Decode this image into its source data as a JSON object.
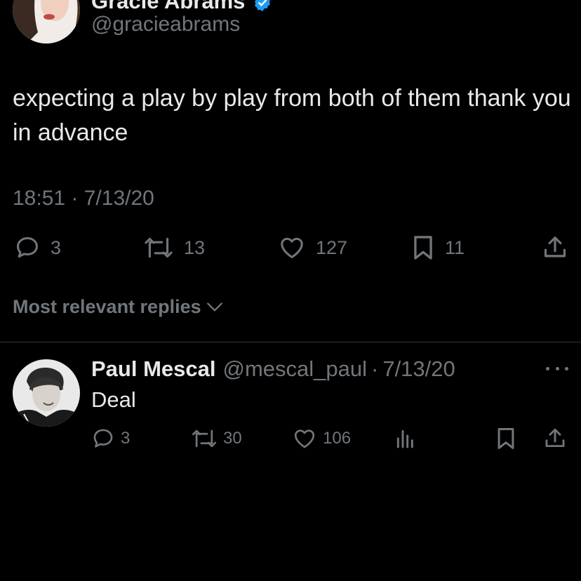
{
  "tweet": {
    "author_name": "Gracie Abrams",
    "author_handle": "@gracieabrams",
    "text": "expecting a play by play from both of them thank you in advance",
    "timestamp": "18:51 · 7/13/20",
    "replies": "3",
    "retweets": "13",
    "likes": "127",
    "bookmarks": "11"
  },
  "replies_sort": {
    "label": "Most relevant replies"
  },
  "reply": {
    "author_name": "Paul Mescal",
    "author_handle": "@mescal_paul",
    "separator": "·",
    "date": "7/13/20",
    "text": "Deal",
    "replies": "3",
    "retweets": "30",
    "likes": "106"
  },
  "colors": {
    "background": "#000000",
    "primary_text": "#e7e9ea",
    "secondary_text": "#71767b",
    "verified_blue": "#1d9bf0",
    "divider": "#2f3336"
  },
  "icons": {
    "reply": "speech-bubble-icon",
    "retweet": "retweet-arrows-icon",
    "like": "heart-icon",
    "bookmark": "bookmark-icon",
    "share": "share-upload-icon",
    "views": "bar-chart-icon",
    "more": "ellipsis-icon",
    "verified": "verified-badge-icon"
  }
}
